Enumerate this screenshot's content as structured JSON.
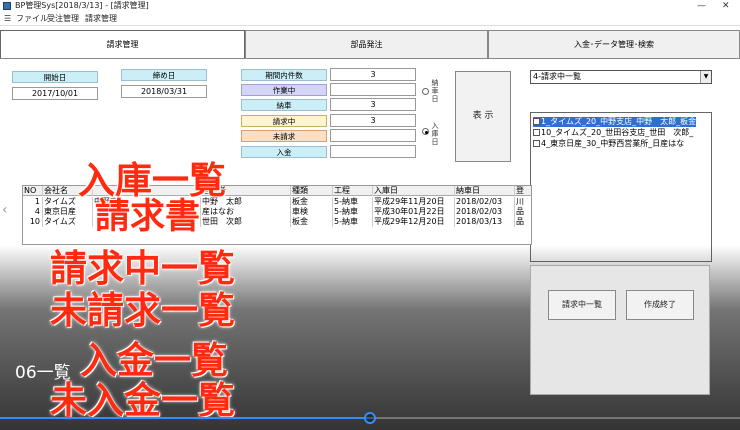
{
  "window": {
    "title": "BP管理Sys[2018/3/13] - [請求管理]",
    "minimize": "—",
    "close": "✕"
  },
  "menu": {
    "items": [
      "ファイル",
      "受注管理",
      "請求管理"
    ]
  },
  "tabs": [
    "請求管理",
    "部品発注",
    "入金･データ管理･検索"
  ],
  "dates": {
    "start_label": "開始日",
    "start_value": "2017/10/01",
    "end_label": "締め日",
    "end_value": "2018/03/31"
  },
  "counts": {
    "period_label": "期間内件数",
    "period_value": "3",
    "working_label": "作業中",
    "working_value": "",
    "delivered_label": "納車",
    "delivered_value": "3",
    "billing_label": "請求中",
    "billing_value": "3",
    "unbilled_label": "未請求",
    "unbilled_value": "",
    "payment_label": "入金",
    "payment_value": ""
  },
  "radios": {
    "delivery_label": "納車日",
    "entry_label": "入庫日",
    "selected": "entry"
  },
  "display_button": "表 示",
  "dropdown": {
    "value": "4-請求中一覧"
  },
  "list_items": [
    "1_タイムズ_20_中野支店_中野　太郎_板金",
    "10_タイムズ_20_世田谷支店_世田　次郎_",
    "4_東京日産_30_中野西営業所_日産はな"
  ],
  "grid": {
    "columns": [
      "NO",
      "会社名",
      "",
      "担当者",
      "種類",
      "工程",
      "入庫日",
      "納車日",
      "登"
    ],
    "rows": [
      [
        "1",
        "タイムズ",
        "中野支",
        "中野　太郎",
        "板金",
        "5-納車",
        "平成29年11月20日",
        "2018/02/03",
        "川"
      ],
      [
        "4",
        "東京日産",
        "",
        "産はなお",
        "車検",
        "5-納車",
        "平成30年01月22日",
        "2018/02/03",
        "品"
      ],
      [
        "10",
        "タイムズ",
        "",
        "世田　次郎",
        "板金",
        "5-納車",
        "平成29年12月20日",
        "2018/03/13",
        "品"
      ]
    ]
  },
  "buttons": {
    "billing_list": "請求中一覧",
    "finish": "作成終了"
  },
  "overlay": {
    "lines": [
      "入庫一覧",
      "請求書",
      "請求中一覧",
      "未請求一覧",
      "入金一覧",
      "未入金一覧"
    ],
    "caption": "06一覧"
  },
  "progress": {
    "percent": 50
  },
  "colors": {
    "overlay_text": "#ff2a10",
    "progress": "#2f8fff",
    "selection": "#2f6fd0"
  }
}
